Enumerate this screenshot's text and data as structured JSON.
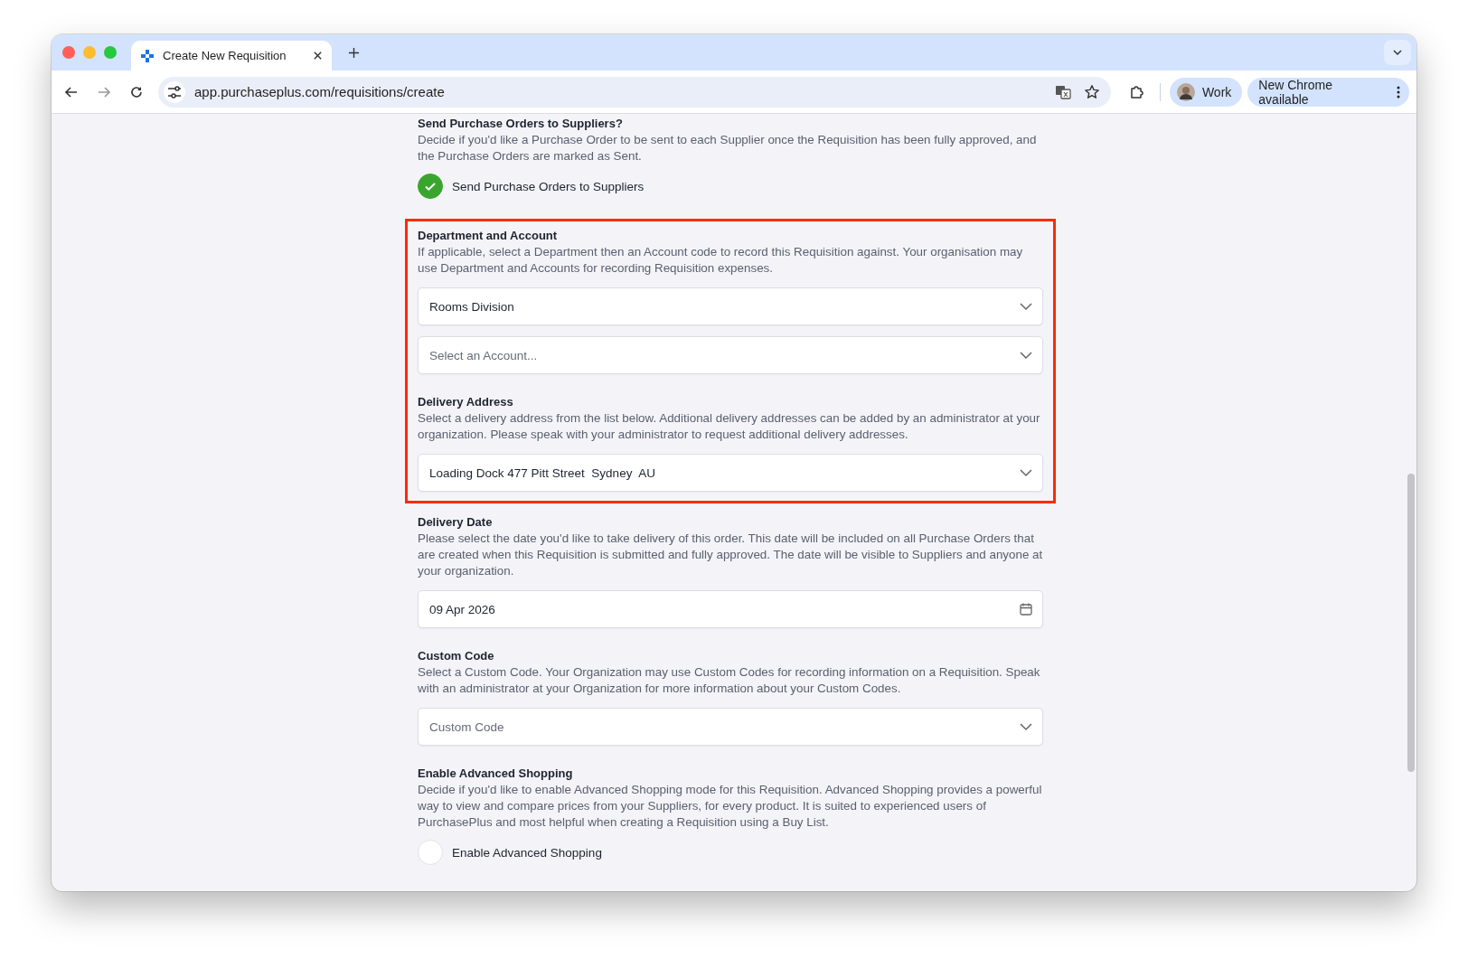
{
  "browser": {
    "tabs": [
      {
        "title": "Create New Requisition",
        "selected": true
      }
    ],
    "url": "app.purchaseplus.com/requisitions/create",
    "profile": "Work",
    "update_button": "New Chrome available"
  },
  "groups": [
    {
      "highlighted": false,
      "sections": [
        {
          "title": "Send Purchase Orders to Suppliers?",
          "description": "Decide if you'd like a Purchase Order to be sent to each Supplier once the Requisition has been fully approved, and the Purchase Orders are marked as Sent.",
          "fields": [
            {
              "kind": "toggle",
              "label": "Send Purchase Orders to Suppliers",
              "checked": true
            }
          ]
        }
      ]
    },
    {
      "highlighted": true,
      "sections": [
        {
          "title": "Department and Account",
          "description": "If applicable, select a Department then an Account code to record this Requisition against. Your organisation may use Department and Accounts for recording Requisition expenses.",
          "fields": [
            {
              "kind": "select",
              "value": "Rooms Division"
            },
            {
              "kind": "select",
              "placeholder": "Select an Account..."
            }
          ]
        },
        {
          "title": "Delivery Address",
          "description": "Select a delivery address from the list below. Additional delivery addresses can be added by an administrator at your organization. Please speak with your administrator to request additional delivery addresses.",
          "fields": [
            {
              "kind": "select",
              "value": "Loading Dock 477 Pitt Street  Sydney  AU"
            }
          ]
        }
      ]
    },
    {
      "highlighted": false,
      "sections": [
        {
          "title": "Delivery Date",
          "description": "Please select the date you'd like to take delivery of this order. This date will be included on all Purchase Orders that are created when this Requisition is submitted and fully approved. The date will be visible to Suppliers and anyone at your organization.",
          "fields": [
            {
              "kind": "date",
              "value": "09 Apr 2026"
            }
          ]
        },
        {
          "title": "Custom Code",
          "description": "Select a Custom Code. Your Organization may use Custom Codes for recording information on a Requisition. Speak with an administrator at your Organization for more information about your Custom Codes.",
          "fields": [
            {
              "kind": "select",
              "placeholder": "Custom Code"
            }
          ]
        },
        {
          "title": "Enable Advanced Shopping",
          "description": "Decide if you'd like to enable Advanced Shopping mode for this Requisition. Advanced Shopping provides a powerful way to view and compare prices from your Suppliers, for every product. It is suited to experienced users of PurchasePlus and most helpful when creating a Requisition using a Buy List.",
          "fields": [
            {
              "kind": "toggle",
              "label": "Enable Advanced Shopping",
              "checked": false
            }
          ]
        }
      ]
    }
  ]
}
